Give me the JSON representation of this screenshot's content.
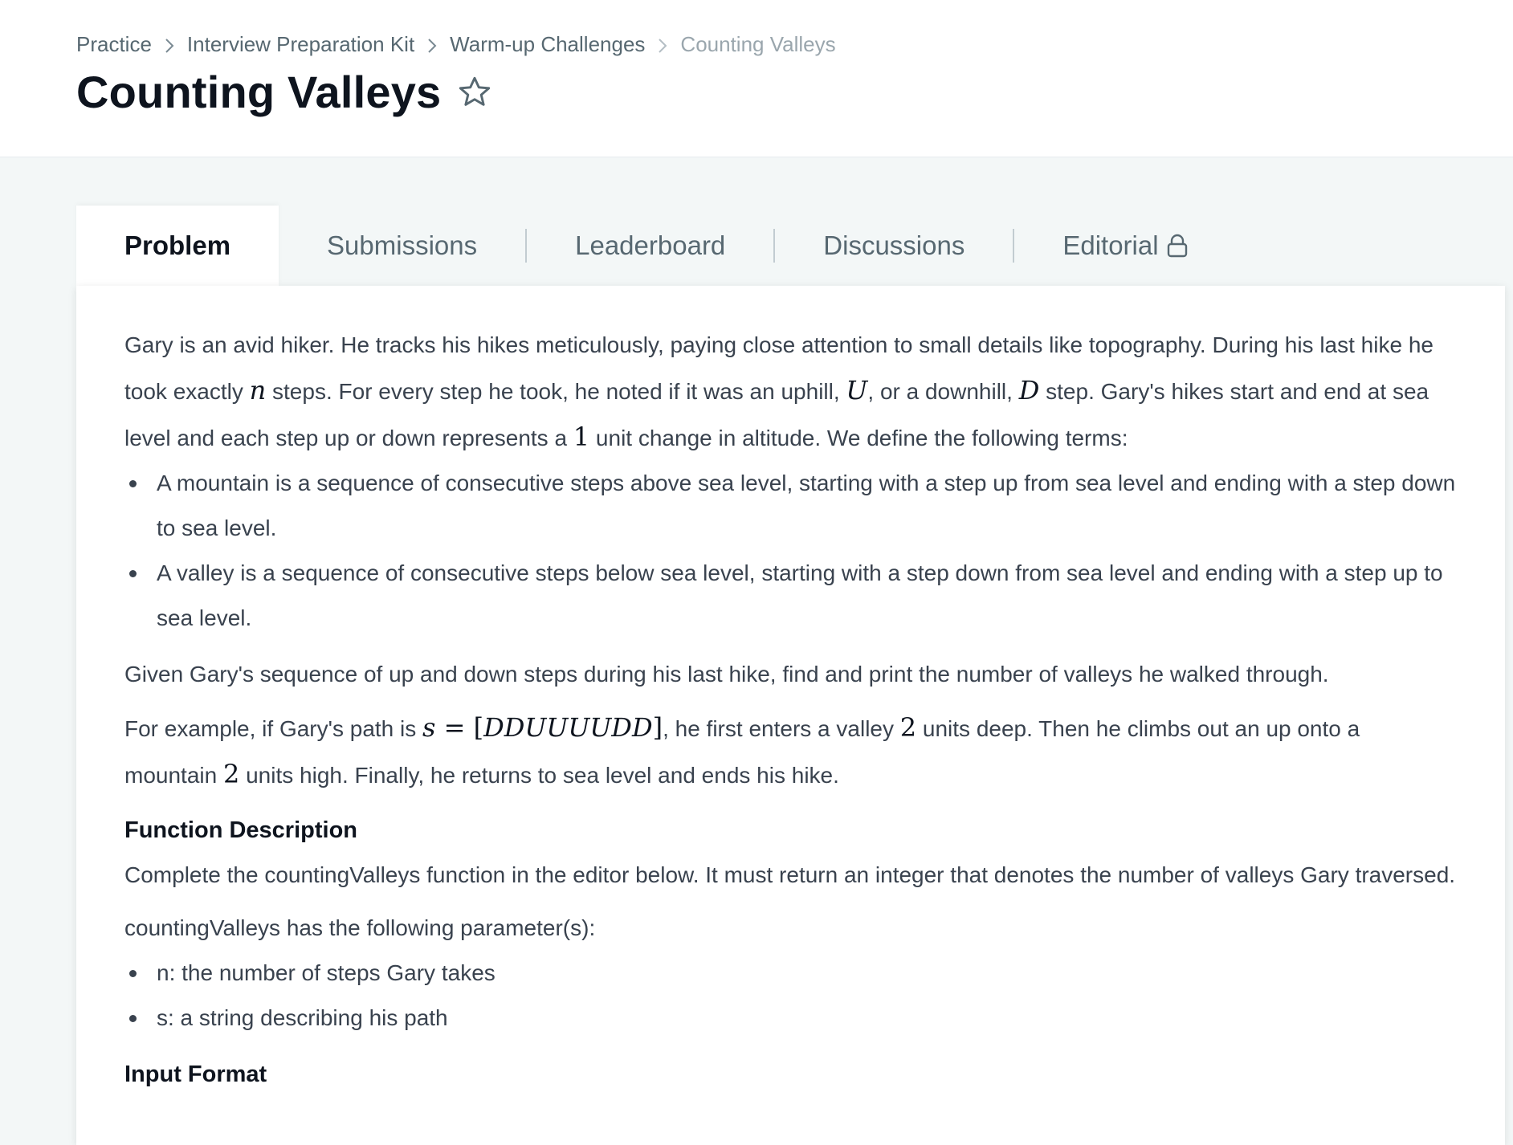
{
  "breadcrumb": {
    "items": [
      "Practice",
      "Interview Preparation Kit",
      "Warm-up Challenges"
    ],
    "current": "Counting Valleys"
  },
  "page": {
    "title": "Counting Valleys"
  },
  "tabs": [
    {
      "label": "Problem",
      "active": true
    },
    {
      "label": "Submissions"
    },
    {
      "label": "Leaderboard"
    },
    {
      "label": "Discussions"
    },
    {
      "label": "Editorial",
      "icon": "lock-icon"
    }
  ],
  "problem": {
    "intro": {
      "t1": "Gary is an avid hiker. He tracks his hikes meticulously, paying close attention to small details like topography. During his last hike he took exactly ",
      "m1": "n",
      "t2": " steps. For every step he took, he noted if it was an uphill, ",
      "m2": "U",
      "t3": ", or a downhill, ",
      "m3": "D",
      "t4": " step. Gary's hikes start and end at sea level and each step up or down represents a ",
      "m4": "1",
      "t5": " unit change in altitude. We define the following terms:"
    },
    "definitions": [
      "A mountain is a sequence of consecutive steps above sea level, starting with a step up from sea level and ending with a step down to sea level.",
      "A valley is a sequence of consecutive steps below sea level, starting with a step down from sea level and ending with a step up to sea level."
    ],
    "task": "Given Gary's sequence of up and down steps during his last hike, find and print the number of valleys he walked through.",
    "example": {
      "t1": "For example, if Gary's path is ",
      "m1": "s",
      "m1b": " = [",
      "m1c": "DDUUUUDD",
      "m1d": "]",
      "t2": ", he first enters a valley ",
      "m2": "2",
      "t3": " units deep. Then he climbs out an up onto a mountain ",
      "m3": "2",
      "t4": " units high. Finally, he returns to sea level and ends his hike."
    },
    "function_heading": "Function Description",
    "function_desc": "Complete the countingValleys function in the editor below. It must return an integer that denotes the number of valleys Gary traversed.",
    "params_intro": "countingValleys has the following parameter(s):",
    "params": [
      "n: the number of steps Gary takes",
      "s: a string describing his path"
    ],
    "input_heading": "Input Format"
  }
}
